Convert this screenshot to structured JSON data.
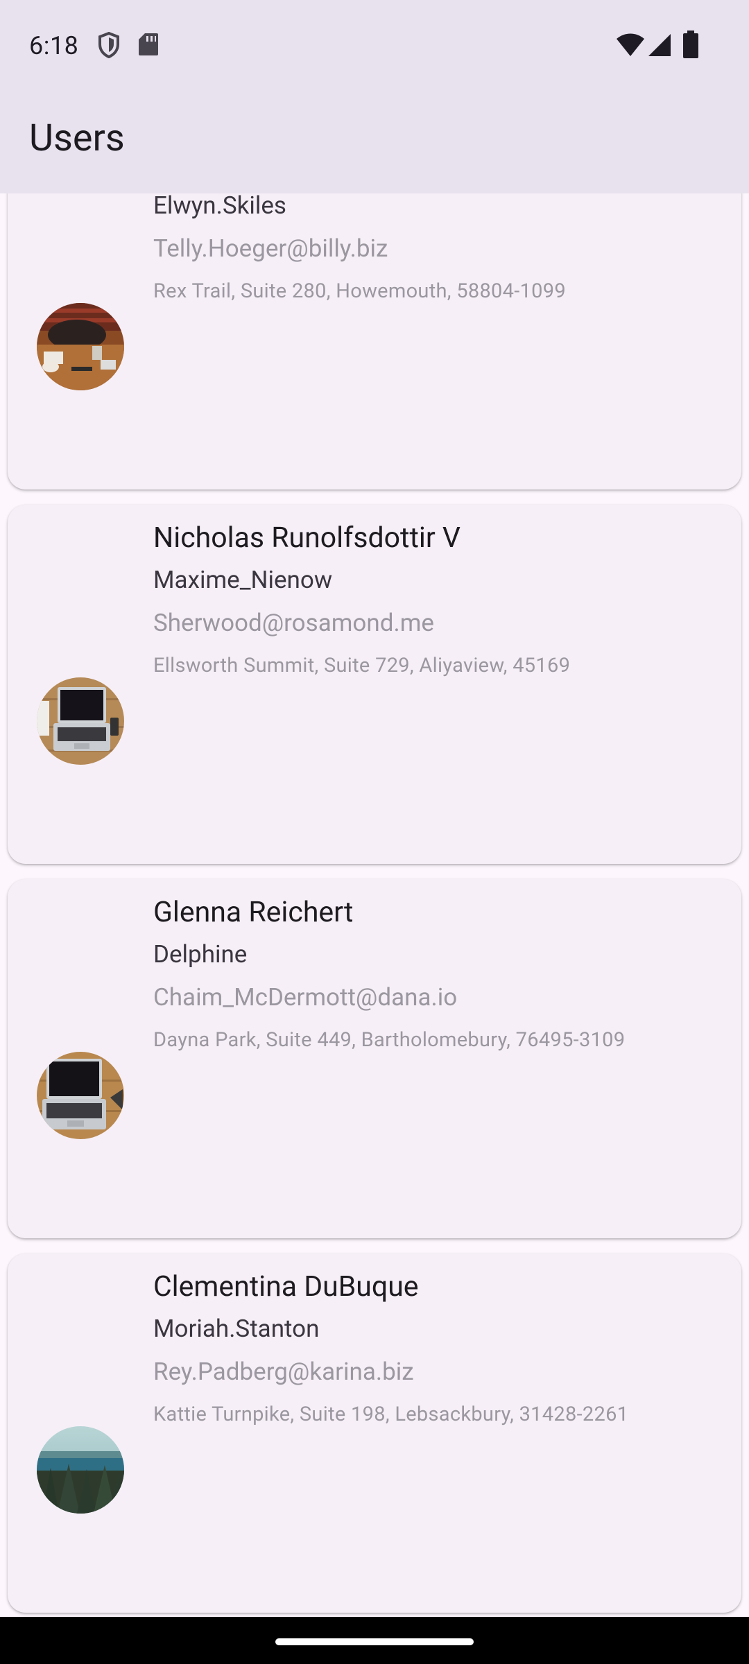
{
  "status_bar": {
    "time": "6:18",
    "icons_left": [
      "shield-icon",
      "sd-card-icon"
    ],
    "icons_right": [
      "wifi-icon",
      "cellular-signal-icon",
      "battery-icon"
    ]
  },
  "app_bar": {
    "title": "Users"
  },
  "users": [
    {
      "name": "",
      "username": "Elwyn.Skiles",
      "email": "Telly.Hoeger@billy.biz",
      "address": "Rex Trail, Suite 280, Howemouth, 58804-1099",
      "avatar": "photo-desk-coffee"
    },
    {
      "name": "Nicholas Runolfsdottir V",
      "username": "Maxime_Nienow",
      "email": "Sherwood@rosamond.me",
      "address": "Ellsworth Summit, Suite 729, Aliyaview, 45169",
      "avatar": "photo-laptop"
    },
    {
      "name": "Glenna Reichert",
      "username": "Delphine",
      "email": "Chaim_McDermott@dana.io",
      "address": "Dayna Park, Suite 449, Bartholomebury, 76495-3109",
      "avatar": "photo-laptop"
    },
    {
      "name": "Clementina DuBuque",
      "username": "Moriah.Stanton",
      "email": "Rey.Padberg@karina.biz",
      "address": "Kattie Turnpike, Suite 198, Lebsackbury, 31428-2261",
      "avatar": "photo-forest-lake"
    }
  ]
}
